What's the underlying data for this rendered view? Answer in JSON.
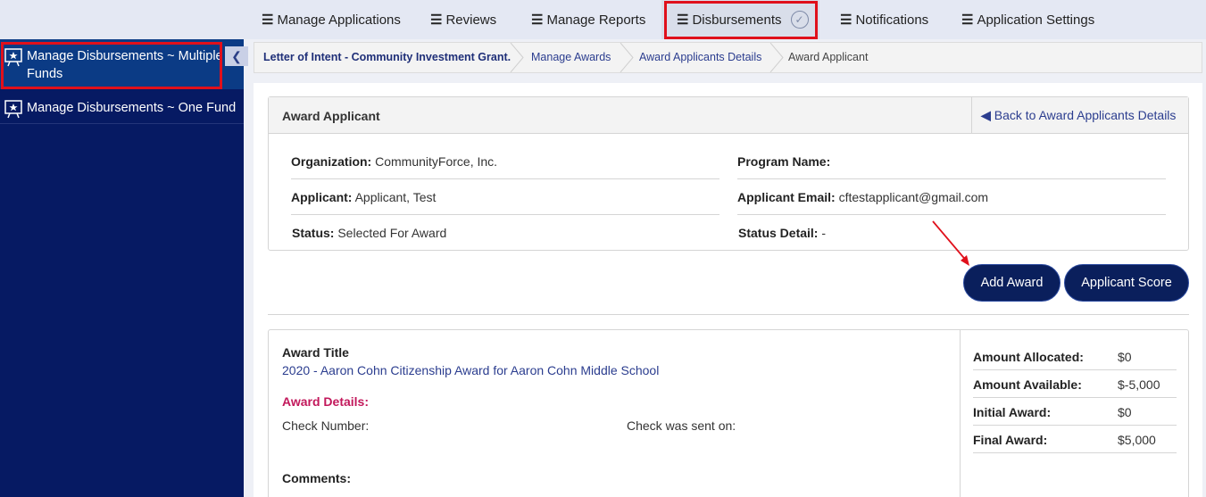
{
  "topnav": {
    "items": [
      {
        "label": "Manage Applications"
      },
      {
        "label": "Reviews"
      },
      {
        "label": "Manage Reports"
      },
      {
        "label": "Disbursements"
      },
      {
        "label": "Notifications"
      },
      {
        "label": "Application Settings"
      }
    ]
  },
  "sidebar": {
    "items": [
      {
        "label": "Manage Disbursements ~ Multiple Funds"
      },
      {
        "label": "Manage Disbursements ~ One Fund"
      }
    ]
  },
  "breadcrumb": [
    {
      "label": "Letter of Intent - Community Investment Grant."
    },
    {
      "label": "Manage Awards"
    },
    {
      "label": "Award Applicants Details"
    },
    {
      "label": "Award Applicant"
    }
  ],
  "card": {
    "title": "Award Applicant",
    "back_link": "Back to Award Applicants Details",
    "fields": {
      "organization_label": "Organization:",
      "organization_value": "CommunityForce, Inc.",
      "program_label": "Program Name:",
      "program_value": "",
      "applicant_label": "Applicant:",
      "applicant_value": "Applicant, Test",
      "email_label": "Applicant Email:",
      "email_value": "cftestapplicant@gmail.com",
      "status_label": "Status:",
      "status_value": "Selected For Award",
      "status_detail_label": "Status Detail:",
      "status_detail_value": "-"
    }
  },
  "buttons": {
    "add_award": "Add Award",
    "applicant_score": "Applicant Score"
  },
  "award": {
    "title_label": "Award Title",
    "title_value": "2020 - Aaron Cohn Citizenship Award for Aaron Cohn Middle School",
    "details_label": "Award Details:",
    "check_number_label": "Check Number:",
    "check_sent_label": "Check was sent on:",
    "comments_label": "Comments:",
    "amounts": [
      {
        "label": "Amount Allocated:",
        "value": "$0"
      },
      {
        "label": "Amount Available:",
        "value": "$-5,000"
      },
      {
        "label": "Initial Award:",
        "value": "$0"
      },
      {
        "label": "Final Award:",
        "value": "$5,000"
      }
    ]
  },
  "colors": {
    "accent_red": "#e0101b",
    "sidebar_bg": "#061a63",
    "button_bg": "#0a1f5c",
    "award_details": "#c2185b",
    "link": "#2b3d8f"
  }
}
